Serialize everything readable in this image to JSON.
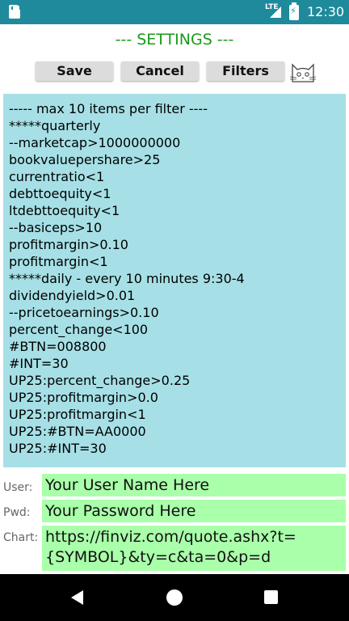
{
  "status_bar": {
    "network": "LTE",
    "time": "12:30",
    "icons": [
      "sd-card-icon",
      "signal-icon",
      "battery-charging-icon"
    ]
  },
  "header": {
    "title": "--- SETTINGS ---"
  },
  "toolbar": {
    "save_label": "Save",
    "cancel_label": "Cancel",
    "filters_label": "Filters",
    "mascot_icon": "cat-icon"
  },
  "filters_text": "----- max 10 items per filter ----\n*****quarterly\n--marketcap>1000000000\nbookvaluepershare>25\ncurrentratio<1\ndebttoequity<1\nltdebttoequity<1\n--basiceps>10\nprofitmargin>0.10\nprofitmargin<1\n*****daily - every 10 minutes 9:30-4\ndividendyield>0.01\n--pricetoearnings>0.10\npercent_change<100\n#BTN=008800\n#INT=30\nUP25:percent_change>0.25\nUP25:profitmargin>0.0\nUP25:profitmargin<1\nUP25:#BTN=AA0000\nUP25:#INT=30",
  "form": {
    "user_label": "User:",
    "user_value": "Your User Name Here",
    "pwd_label": "Pwd:",
    "pwd_value": "Your Password Here",
    "chart_label": "Chart:",
    "chart_value": "https://finviz.com/quote.ashx?t=\n{SYMBOL}&ty=c&ta=0&p=d"
  },
  "nav_bar": {
    "icons": [
      "back-icon",
      "home-icon",
      "recents-icon"
    ]
  },
  "colors": {
    "status_bar": "#1e8a9c",
    "title_green": "#1a9a1a",
    "filters_bg": "#a6e0e6",
    "field_bg": "#aaffaa",
    "button_bg": "#dcdcdc"
  }
}
